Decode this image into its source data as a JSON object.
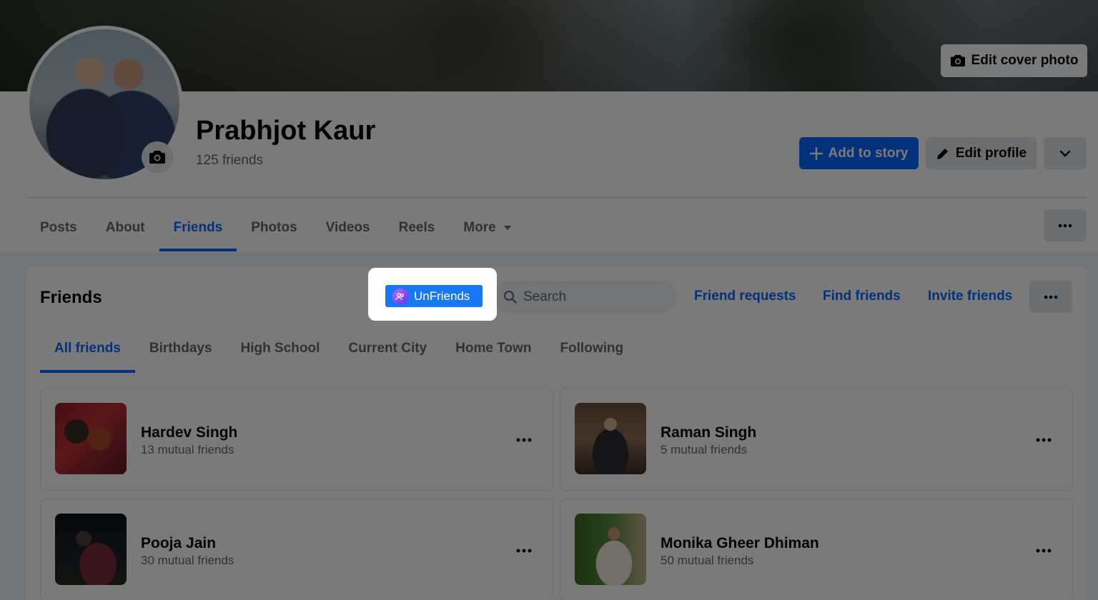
{
  "cover": {
    "edit_cover_label": "Edit cover photo"
  },
  "profile": {
    "name": "Prabhjot Kaur",
    "friend_count": "125 friends",
    "add_story_label": "Add to story",
    "edit_profile_label": "Edit profile"
  },
  "profile_tabs": [
    {
      "label": "Posts"
    },
    {
      "label": "About"
    },
    {
      "label": "Friends",
      "active": true
    },
    {
      "label": "Photos"
    },
    {
      "label": "Videos"
    },
    {
      "label": "Reels"
    },
    {
      "label": "More"
    }
  ],
  "friends_section": {
    "title": "Friends",
    "unfriends_label": "UnFriends",
    "search_placeholder": "Search",
    "friend_requests": "Friend requests",
    "find_friends": "Find friends",
    "invite_friends": "Invite friends"
  },
  "sub_tabs": [
    {
      "label": "All friends",
      "active": true
    },
    {
      "label": "Birthdays"
    },
    {
      "label": "High School"
    },
    {
      "label": "Current City"
    },
    {
      "label": "Home Town"
    },
    {
      "label": "Following"
    }
  ],
  "friends": [
    {
      "name": "Hardev Singh",
      "mutual": "13 mutual friends"
    },
    {
      "name": "Raman Singh",
      "mutual": "5 mutual friends"
    },
    {
      "name": "Pooja Jain",
      "mutual": "30 mutual friends"
    },
    {
      "name": "Monika Gheer Dhiman",
      "mutual": "50 mutual friends"
    }
  ],
  "colors": {
    "accent": "#0866ff",
    "overlay": "#000000",
    "unfriends_button": "#1877f2"
  }
}
